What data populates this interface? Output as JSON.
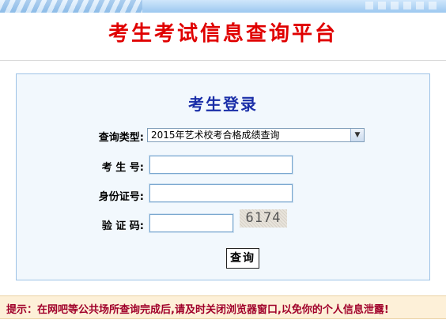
{
  "header": {
    "title": "考生考试信息查询平台"
  },
  "login": {
    "heading": "考生登录",
    "query_type_label": "查询类型:",
    "query_type_selected": "2015年艺术校考合格成绩查询",
    "exam_no_label": "考 生 号:",
    "exam_no_value": "",
    "id_no_label": "身份证号:",
    "id_no_value": "",
    "captcha_label": "验 证 码:",
    "captcha_value": "",
    "captcha_image_text": "6174",
    "submit_label": "查询"
  },
  "tip": {
    "text": "提示：在网吧等公共场所查询完成后,请及时关闭浏览器窗口,以免你的个人信息泄露!"
  },
  "colors": {
    "title_red": "#e00000",
    "heading_blue": "#1a2ea8",
    "tip_red": "#a0002a",
    "panel_bg": "#f2f8fd"
  }
}
